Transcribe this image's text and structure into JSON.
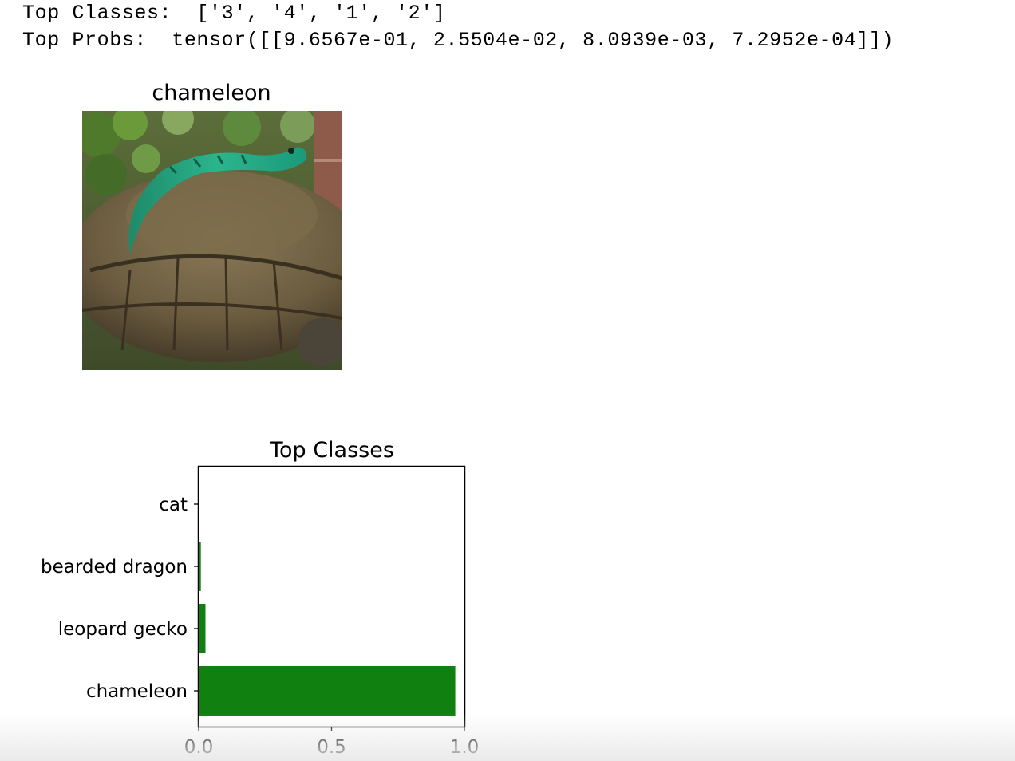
{
  "output": {
    "line1": "Top Classes:  ['3', '4', '1', '2']",
    "line2": "Top Probs:  tensor([[9.6567e-01, 2.5504e-02, 8.0939e-03, 7.2952e-04]])"
  },
  "image_panel": {
    "title": "chameleon"
  },
  "chart_data": {
    "type": "bar",
    "orientation": "horizontal",
    "title": "Top Classes",
    "xlabel": "",
    "ylabel": "",
    "categories": [
      "chameleon",
      "leopard gecko",
      "bearded dragon",
      "cat"
    ],
    "values": [
      0.96567,
      0.025504,
      0.0080939,
      0.00072952
    ],
    "xlim": [
      0,
      1.0
    ],
    "xticks": [
      0.0,
      0.5,
      1.0
    ],
    "xtick_labels": [
      "0.0",
      "0.5",
      "1.0"
    ],
    "bar_color": "#108010",
    "grid": false
  }
}
